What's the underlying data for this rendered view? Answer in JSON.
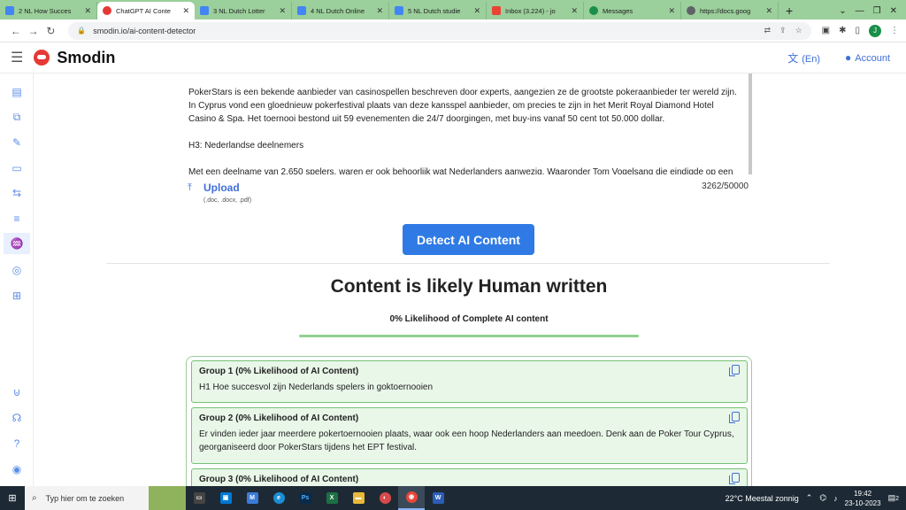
{
  "browser": {
    "tabs": [
      {
        "label": "2 NL How Succes",
        "color": "#4285f4",
        "active": false
      },
      {
        "label": "ChatGPT AI Conte",
        "color": "#e53935",
        "active": true
      },
      {
        "label": "3 NL Dutch Lotter",
        "color": "#4285f4",
        "active": false
      },
      {
        "label": "4 NL Dutch Online",
        "color": "#4285f4",
        "active": false
      },
      {
        "label": "5 NL Dutch studie",
        "color": "#4285f4",
        "active": false
      },
      {
        "label": "Inbox (3.224) - jo",
        "color": "#ea4335",
        "active": false
      },
      {
        "label": "Messages",
        "color": "#1a8f4a",
        "active": false
      },
      {
        "label": "https://docs.goog",
        "color": "#5f6368",
        "active": false
      }
    ],
    "new_tab": "+",
    "url": "smodin.io/ai-content-detector",
    "profile_initial": "J"
  },
  "site": {
    "brand": "Smodin",
    "language": "(En)",
    "account": "Account"
  },
  "editor": {
    "paragraphs": [
      "PokerStars is een bekende aanbieder van casinospellen beschreven door experts, aangezien ze de grootste pokeraanbieder ter wereld zijn. In Cyprus vond een gloednieuw pokerfestival plaats van deze kansspel aanbieder, om precies te zijn in het Merit Royal Diamond Hotel Casino & Spa. Het toernooi bestond uit 59 evenementen die 24/7 doorgingen, met buy-ins vanaf 50 cent tot 50.000 dollar.",
      "H3: Nederlandse deelnemers",
      "Met een deelname van 2.650 spelers, waren er ook behoorlijk wat Nederlanders aanwezig. Waaronder Tom Vogelsang die eindigde op een"
    ],
    "upload_label": "Upload",
    "upload_formats": "(.doc, .docx, .pdf)",
    "char_count": "3262/50000"
  },
  "actions": {
    "detect_label": "Detect AI Content"
  },
  "result": {
    "title": "Content is likely Human written",
    "subtitle": "0% Likelihood of Complete AI content",
    "ai_likelihood_percent": 0,
    "bar_color": "#8fd08f"
  },
  "groups": [
    {
      "title": "Group 1 (0% Likelihood of AI Content)",
      "text": "H1 Hoe succesvol zijn Nederlands spelers in goktoernooien"
    },
    {
      "title": "Group 2 (0% Likelihood of AI Content)",
      "text": "Er vinden ieder jaar meerdere pokertoernooien plaats, waar ook een hoop Nederlanders aan meedoen.  Denk aan de Poker Tour Cyprus, georganiseerd door PokerStars tijdens het EPT festival."
    },
    {
      "title": "Group 3 (0% Likelihood of AI Content)",
      "text": ""
    }
  ],
  "taskbar": {
    "search_placeholder": "Typ hier om te zoeken",
    "weather": "22°C  Meestal zonnig",
    "time": "19:42",
    "date": "23-10-2023",
    "notifications": "2"
  },
  "colors": {
    "accent": "#2f7ae5",
    "success": "#74c274",
    "tabstrip": "#9bcf9b"
  }
}
